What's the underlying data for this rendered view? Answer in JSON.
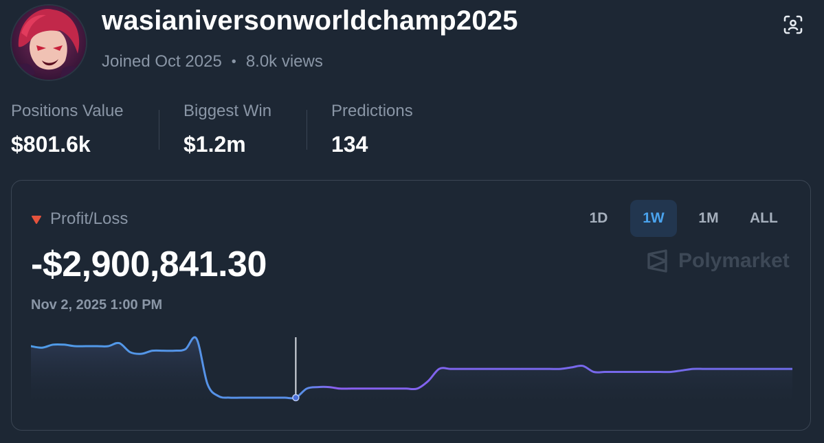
{
  "profile": {
    "username": "wasianiversonworldchamp2025",
    "joined": "Joined Oct 2025",
    "separator": "•",
    "views": "8.0k views"
  },
  "icons": {
    "scan": "scan-face-icon",
    "trend": "triangle-down-icon",
    "brand": "polymarket-logo-icon"
  },
  "stats": [
    {
      "label": "Positions Value",
      "value": "$801.6k"
    },
    {
      "label": "Biggest Win",
      "value": "$1.2m"
    },
    {
      "label": "Predictions",
      "value": "134"
    }
  ],
  "pnl": {
    "label": "Profit/Loss",
    "value": "-$2,900,841.30",
    "timestamp": "Nov 2, 2025 1:00 PM",
    "tabs": [
      "1D",
      "1W",
      "1M",
      "ALL"
    ],
    "active_tab": "1W",
    "brand": "Polymarket"
  },
  "colors": {
    "background": "#1d2734",
    "accent": "#4aa3ee",
    "negative": "#e5533d",
    "line_start": "#4f9ce8",
    "line_end": "#8a5ff0"
  },
  "chart_data": {
    "type": "line",
    "hover_index": 24,
    "values": [
      95,
      94,
      96,
      96,
      95,
      95,
      95,
      95,
      97,
      91,
      90,
      92,
      92,
      92,
      93,
      100,
      70,
      62,
      61,
      61,
      61,
      61,
      61,
      61,
      61,
      67,
      68,
      68,
      67,
      67,
      67,
      67,
      67,
      67,
      67,
      67,
      72,
      80,
      80,
      80,
      80,
      80,
      80,
      80,
      80,
      80,
      80,
      80,
      80,
      81,
      82,
      78,
      78,
      78,
      78,
      78,
      78,
      78,
      78,
      79,
      80,
      80,
      80,
      80,
      80,
      80,
      80,
      80,
      80,
      80
    ]
  }
}
